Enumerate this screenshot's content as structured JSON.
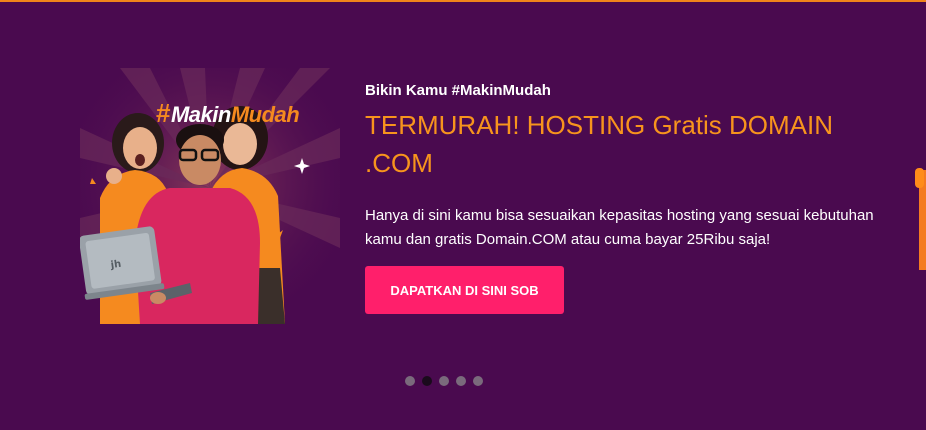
{
  "promo_image": {
    "hashtag": "#MakinMudah",
    "hash_symbol": "#",
    "hashtag_word1": "Makin",
    "hashtag_word2": "Mudah",
    "laptop_logo": "jh"
  },
  "hero": {
    "tagline": "Bikin Kamu #MakinMudah",
    "headline": "TERMURAH! HOSTING Gratis DOMAIN .COM",
    "description_line1": "Hanya di sini kamu bisa sesuaikan kepasitas hosting yang sesuai kebutuhan",
    "description_line2": "kamu dan gratis Domain.COM atau cuma bayar 25Ribu saja!",
    "cta_label": "DAPATKAN DI SINI SOB"
  },
  "carousel": {
    "slide_count": 5,
    "active_index": 1
  },
  "colors": {
    "background": "#4a0a4f",
    "accent_orange": "#f7941d",
    "cta_pink": "#ff1f6b",
    "dot_inactive": "#7a6a7c",
    "dot_active": "#1a0a1c"
  }
}
